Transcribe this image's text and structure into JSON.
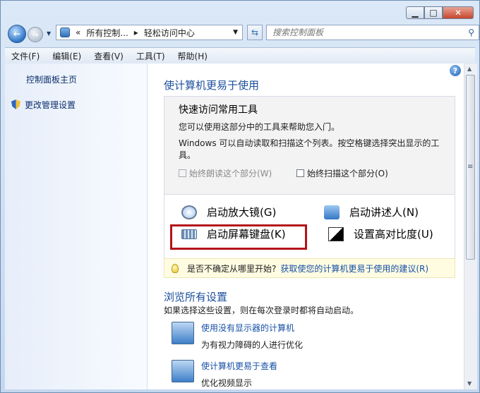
{
  "window": {
    "caption": {
      "minimize": "▁",
      "maximize": "□",
      "close": "✕"
    }
  },
  "nav": {
    "back_glyph": "←",
    "forward_glyph": "→",
    "history_glyph": "▼",
    "address_prefix": "«",
    "breadcrumb": [
      "所有控制...",
      "轻松访问中心"
    ],
    "separator": "▸",
    "address_dropdown": "▼",
    "refresh_glyph": "⇆",
    "search_placeholder": "搜索控制面板",
    "search_icon": "⚲"
  },
  "menu": [
    "文件(F)",
    "编辑(E)",
    "查看(V)",
    "工具(T)",
    "帮助(H)"
  ],
  "left_pane": {
    "home": "控制面板主页",
    "admin": "更改管理设置"
  },
  "main": {
    "help_glyph": "?",
    "title": "使计算机更易于使用",
    "quick": {
      "title": "快速访问常用工具",
      "p1": "您可以使用这部分中的工具来帮助您入门。",
      "p2": "Windows 可以自动读取和扫描这个列表。按空格键选择突出显示的工具。",
      "cb_read": "始终朗读这个部分(W)",
      "cb_scan": "始终扫描这个部分(O)",
      "tools": {
        "magnifier": "启动放大镜(G)",
        "narrator": "启动讲述人(N)",
        "keyboard": "启动屏幕键盘(K)",
        "contrast": "设置高对比度(U)"
      }
    },
    "tip": {
      "prefix": "是否不确定从哪里开始?",
      "link": "获取使您的计算机更易于使用的建议(R)"
    },
    "browse": {
      "title": "浏览所有设置",
      "subtitle": "如果选择这些设置，则在每次登录时都将自动启动。",
      "items": [
        {
          "link": "使用没有显示器的计算机",
          "desc": "为有视力障碍的人进行优化"
        },
        {
          "link": "使计算机更易于查看",
          "desc": "优化视频显示"
        }
      ]
    }
  },
  "scrollbar": {
    "up": "▲",
    "down": "▼",
    "grip": "≡"
  },
  "colors": {
    "accent": "#1a4f9c",
    "link": "#1650a6",
    "highlight": "#b3131a"
  }
}
